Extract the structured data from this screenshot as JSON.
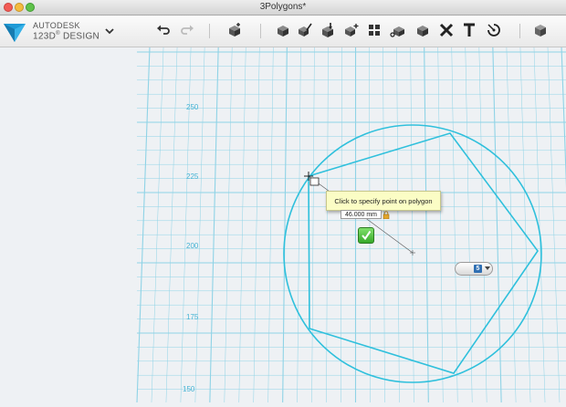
{
  "window": {
    "title": "3Polygons*"
  },
  "brand": {
    "line1": "AUTODESK",
    "line2": "123D",
    "reg": "®",
    "line3": "DESIGN"
  },
  "toolbar": {
    "items": [
      "undo-icon",
      "redo-icon",
      "primitives-icon",
      "sketch-icon",
      "construct-icon",
      "modify-icon",
      "pattern-icon",
      "group-icon",
      "snap-icon",
      "measure-icon",
      "combine-icon",
      "text-icon",
      "material-icon",
      "view-cube-icon"
    ]
  },
  "axis": {
    "labels": [
      "250",
      "225",
      "200",
      "175",
      "150"
    ]
  },
  "hint": {
    "text": "Click to specify point on polygon"
  },
  "dimension": {
    "value": "46.000 mm"
  },
  "sides": {
    "value": "5"
  },
  "colors": {
    "grid": "#8fd3e6",
    "shape": "#2fc0dc",
    "accent": "#1aa0d0"
  }
}
